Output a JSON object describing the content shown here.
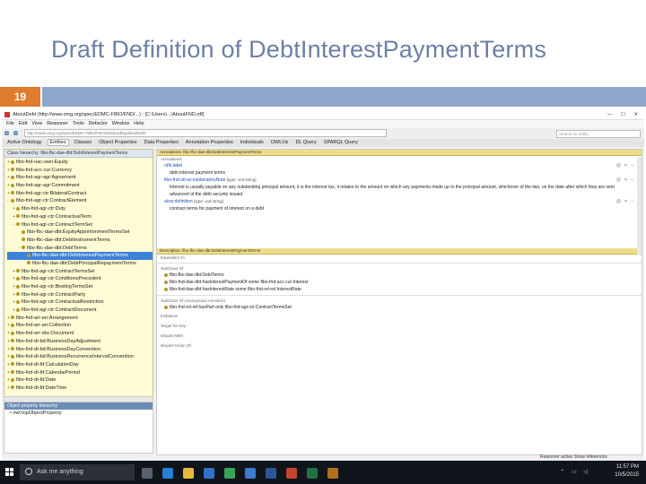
{
  "slide": {
    "title": "Draft Definition of DebtInterestPaymentTerms",
    "number": "19"
  },
  "window": {
    "title": "AboutDebt (http://www.omg.org/spec/EDMC-FIBO/FND/...) : [C:\\Users\\...\\AboutFND.rdf]",
    "menu": [
      "File",
      "Edit",
      "View",
      "Reasoner",
      "Tools",
      "Refactor",
      "Window",
      "Help"
    ],
    "address": "http://www.omg.org/spec/EDMC-FIBO/FBC/DebtAndEquities/Debt/",
    "search_placeholder": "Search for entity",
    "tabs": [
      "Active Ontology",
      "Entities",
      "Classes",
      "Object Properties",
      "Data Properties",
      "Annotation Properties",
      "Individuals",
      "OWLViz",
      "DL Query",
      "SPARQL Query"
    ],
    "active_tab": "Entities"
  },
  "left_panel": {
    "header": "Class hierarchy: fibo-fbc-dae-dbt:DebtInterestPaymentTerms",
    "tree": [
      {
        "label": "fibo-fnd-oac-own:Equity",
        "expand": "+"
      },
      {
        "label": "fibo-fnd-acc-cur:Currency",
        "expand": "+"
      },
      {
        "label": "fibo-fnd-agr-agr:Agreement",
        "expand": "+"
      },
      {
        "label": "fibo-fnd-agr-agr:Commitment",
        "expand": "+"
      },
      {
        "label": "fibo-fnd-agr-ctr:BilateralContract",
        "expand": "+"
      },
      {
        "label": "fibo-fnd-agr-ctr:ContractElement",
        "expand": "-"
      },
      {
        "label": "fibo-fnd-agr-ctr:Duty",
        "expand": "+"
      },
      {
        "label": "fibo-fnd-agr-ctr:ContractualTerm",
        "expand": "+"
      },
      {
        "label": "fibo-fnd-agr-ctr:ContractTermSet",
        "expand": "-"
      },
      {
        "label": "fibo-fbc-dae-dbt:EquityApportionmentTermsSet",
        "expand": ""
      },
      {
        "label": "fibo-fbc-dae-dbt:DebtInstrumentTerms",
        "expand": ""
      },
      {
        "label": "fibo-fbc-dae-dbt:DebtTerms",
        "expand": "-"
      },
      {
        "label": "fibo-fbc-dae-dbt:DebtInterestPaymentTerms",
        "expand": "",
        "selected": true
      },
      {
        "label": "fibo-fbc-dae-dbt:DebtPrincipalRepaymentTerms",
        "expand": ""
      },
      {
        "label": "fibo-fnd-agr-ctr:ContractTermsSet",
        "expand": "+"
      },
      {
        "label": "fibo-fnd-agr-ctr:ConditionsPrecedent",
        "expand": "+"
      },
      {
        "label": "fibo-fnd-agr-ctr:BindingTermsSet",
        "expand": "+"
      },
      {
        "label": "fibo-fnd-agr-ctr:ContractParty",
        "expand": "+"
      },
      {
        "label": "fibo-fnd-agr-ctr:ContractualRestriction",
        "expand": "+"
      },
      {
        "label": "fibo-fnd-agr-ctr:ContractDocument",
        "expand": "+"
      },
      {
        "label": "fibo-fnd-arr-arr:Arrangement",
        "expand": "+"
      },
      {
        "label": "fibo-fnd-arr-arr:Collection",
        "expand": "+"
      },
      {
        "label": "fibo-fnd-arr-doc:Document",
        "expand": "+"
      },
      {
        "label": "fibo-fnd-dt-bd:BusinessDayAdjustment",
        "expand": "+"
      },
      {
        "label": "fibo-fnd-dt-bd:BusinessDayConvention",
        "expand": "+"
      },
      {
        "label": "fibo-fnd-dt-bd:BusinessRecurrenceIntervalConvention",
        "expand": "+"
      },
      {
        "label": "fibo-fnd-dt-fd:CalculationDay",
        "expand": "+"
      },
      {
        "label": "fibo-fnd-dt-fd:CalendarPeriod",
        "expand": "+"
      },
      {
        "label": "fibo-fnd-dt-fd:Date",
        "expand": "+"
      },
      {
        "label": "fibo-fnd-dt-fd:DateTime",
        "expand": "+"
      }
    ]
  },
  "prop_panel": {
    "header": "Object property hierarchy",
    "item": "owl:topObjectProperty"
  },
  "right_panel": {
    "annotations_header": "Annotations: fibo-fbc-dae-dbt:DebtInterestPaymentTerms",
    "annotations_label": "Annotations",
    "rdfs_label": "rdfs:label",
    "label_value": "debt interest payment terms",
    "definition_key": "fibo-fnd-utl-av:explanatoryNote",
    "definition_type": "[type: xsd:string]",
    "definition_text": "Interest is usually payable on any outstanding principal amount, it is the interest tax, it relates to the amount on which any payments made up to the principal amount, whichever of the two, on the date after which they are sent",
    "definition_text2": "advanced of the debt security issued.",
    "skos_key": "skos:definition",
    "skos_type": "[type: xsd:string]",
    "skos_text": "contract terms for payment of interest on a debt",
    "description_header": "Description: fibo-fbc-dae-dbt:DebtInterestPaymentTerms",
    "equivalent_label": "Equivalent To",
    "subclass_label": "SubClass Of",
    "subclass_items": [
      "fibo-fbc-dae-dbt:DebtTerms",
      "fibo-fnd-dae-dbt:hasInterestPaymentOf some fibo-fnd-acc-cur:Interest",
      "fibo-fnd-dae-dbt:hasInterestRate some fibo-fnd-rel-rel:InterestRate"
    ],
    "anon_label": "SubClass Of (Anonymous Ancestor)",
    "anon_item": "fibo-fnd-rel-rel:hasPart only fibo-fnd-agr-ctr:ContractTermsSet",
    "other_labels": [
      "Instances",
      "Target for Key",
      "Disjoint With",
      "Disjoint Union Of"
    ],
    "status": "Reasoner active   Show Inferences"
  },
  "taskbar": {
    "search_text": "Ask me anything",
    "time": "11:57 PM",
    "date": "10/5/2015",
    "apps": [
      {
        "name": "task-view-icon",
        "color": "#5a6270"
      },
      {
        "name": "edge-icon",
        "color": "#2a7fd4"
      },
      {
        "name": "file-explorer-icon",
        "color": "#e8b83a"
      },
      {
        "name": "store-icon",
        "color": "#2f72c6"
      },
      {
        "name": "chrome-icon",
        "color": "#3aa35a"
      },
      {
        "name": "mail-icon",
        "color": "#3a7ad1"
      },
      {
        "name": "word-icon",
        "color": "#2b5797"
      },
      {
        "name": "powerpoint-icon",
        "color": "#c5442b"
      },
      {
        "name": "excel-icon",
        "color": "#207245"
      },
      {
        "name": "java-icon",
        "color": "#b07219"
      }
    ]
  },
  "colors": {
    "title": "#6d7fa5",
    "slide_number_bg": "#e07c2e",
    "slide_bar": "#8ea6c9",
    "tree_bg": "#fffbd4",
    "selection": "#3d82d9"
  }
}
